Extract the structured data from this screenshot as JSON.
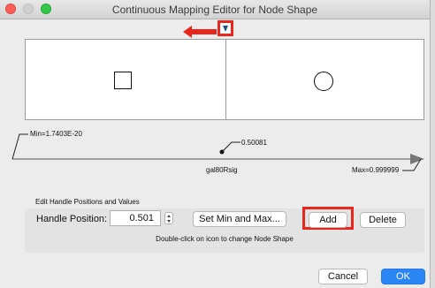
{
  "window": {
    "title": "Continuous Mapping Editor for Node Shape"
  },
  "annotations": {
    "highlight_color": "#e8261c"
  },
  "handle": {
    "min_label": "Min=1.7403E-20",
    "value_label": "0.50081",
    "max_label": "Max=0.999999",
    "attribute_label": "gal80Rsig"
  },
  "edit": {
    "section_title": "Edit Handle Positions and Values",
    "position_label": "Handle Position:",
    "position_value": "0.501",
    "set_min_max_label": "Set Min and Max...",
    "add_label": "Add",
    "delete_label": "Delete",
    "hint": "Double-click on icon to change Node Shape"
  },
  "footer": {
    "cancel_label": "Cancel",
    "ok_label": "OK"
  },
  "colors": {
    "ok_button": "#2a86f4",
    "toggle_arrow": "#1b4f8a"
  }
}
